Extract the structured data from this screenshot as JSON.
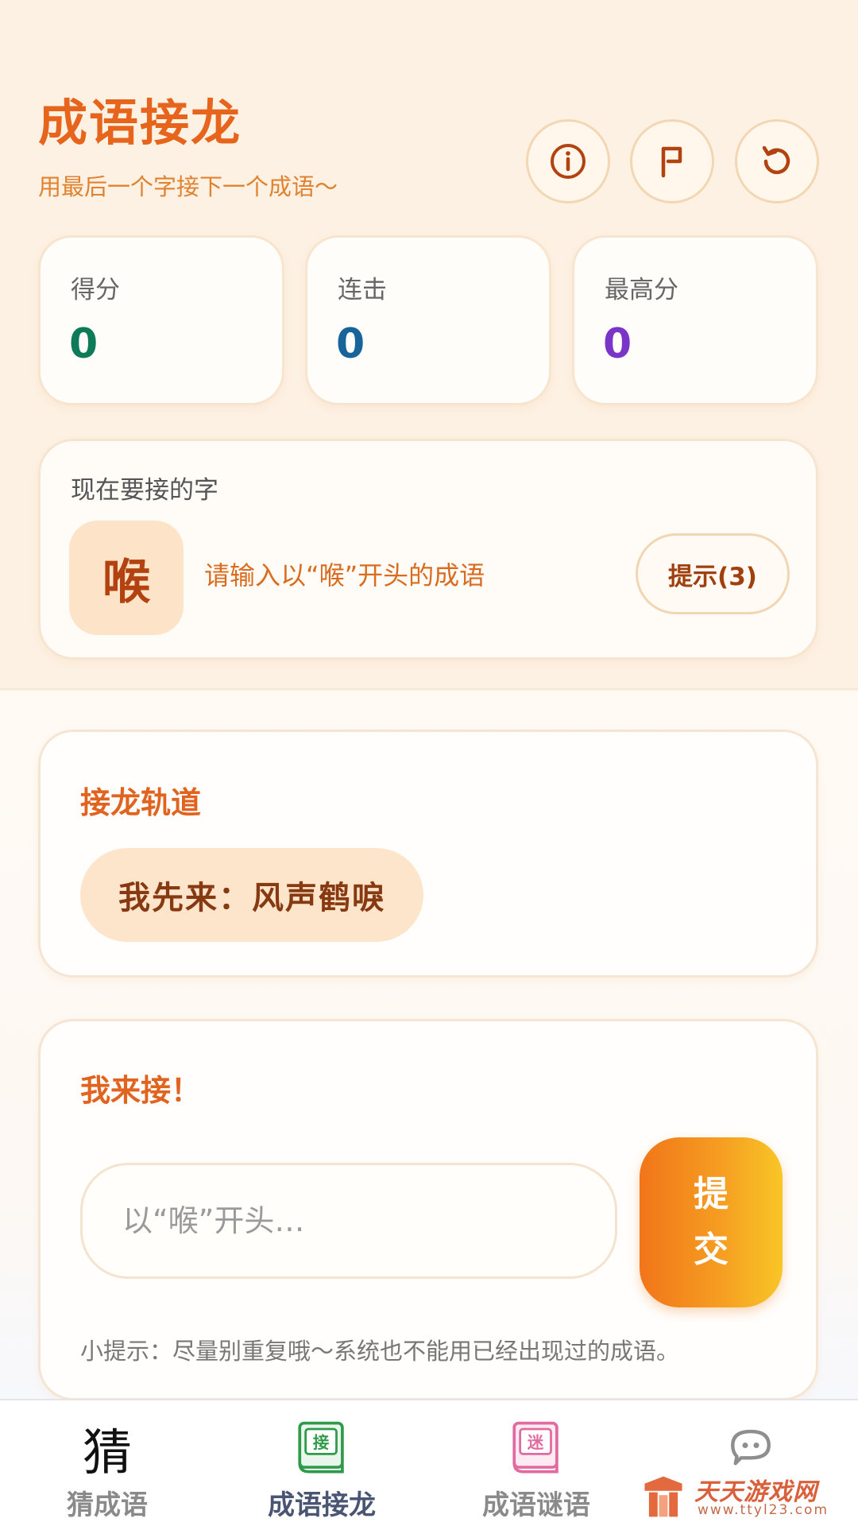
{
  "header": {
    "title": "成语接龙",
    "subtitle": "用最后一个字接下一个成语～"
  },
  "stats": [
    {
      "label": "得分",
      "value": "0",
      "color": "#0f7a58"
    },
    {
      "label": "连击",
      "value": "0",
      "color": "#16649a"
    },
    {
      "label": "最高分",
      "value": "0",
      "color": "#7a35c8"
    }
  ],
  "current": {
    "label": "现在要接的字",
    "char": "喉",
    "prompt": "请输入以“喉”开头的成语",
    "hint_button": "提示(3)"
  },
  "track": {
    "title": "接龙轨道",
    "items": [
      "我先来：风声鹤唳"
    ]
  },
  "answer": {
    "title": "我来接！",
    "placeholder": "以“喉”开头…",
    "value": "",
    "submit_label": "提交",
    "tip": "小提示：尽量别重复哦～系统也不能用已经出现过的成语。"
  },
  "tabs": [
    {
      "label": "猜成语",
      "icon": "cai-char-icon",
      "glyph": "猜"
    },
    {
      "label": "成语接龙",
      "icon": "jie-book-icon",
      "glyph": "接",
      "active": true
    },
    {
      "label": "成语谜语",
      "icon": "mi-book-icon",
      "glyph": "迷"
    },
    {
      "label": "",
      "icon": "chat-face-icon"
    }
  ],
  "watermark": {
    "title": "天天游戏网",
    "url": "www.ttyl23.com"
  },
  "colors": {
    "accent": "#e6641b",
    "submit_gradient_start": "#f17519",
    "submit_gradient_end": "#f8c627"
  }
}
